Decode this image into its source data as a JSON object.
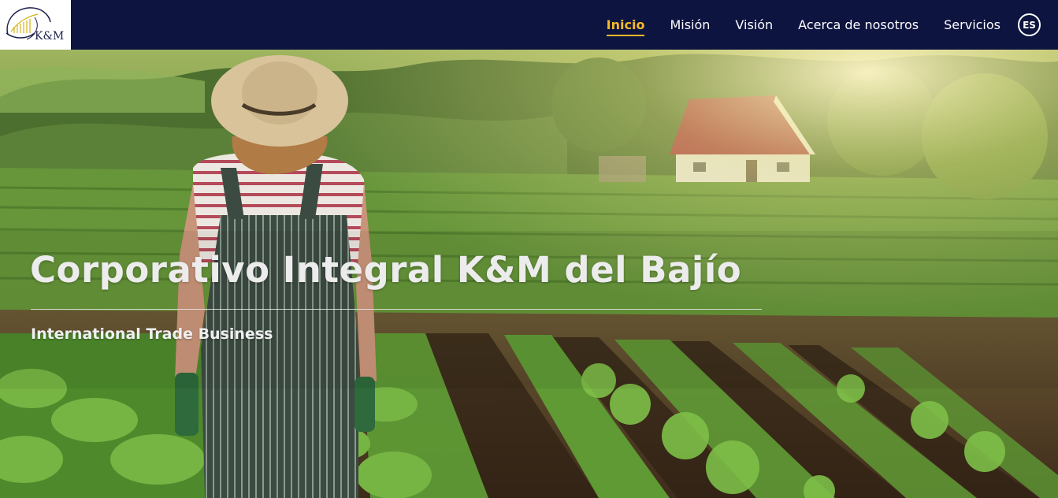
{
  "header": {
    "logo_text": "K&M",
    "nav": [
      {
        "label": "Inicio",
        "active": true
      },
      {
        "label": "Misión",
        "active": false
      },
      {
        "label": "Visión",
        "active": false
      },
      {
        "label": "Acerca de nosotros",
        "active": false
      },
      {
        "label": "Servicios",
        "active": false
      }
    ],
    "language": "ES"
  },
  "hero": {
    "title": "Corporativo Integral K&M del Bajío",
    "subtitle": "International Trade Business",
    "image": "farmer-in-field-image"
  },
  "colors": {
    "navbar_bg": "#0d1440",
    "accent": "#f5b928",
    "text_light": "#ececec"
  }
}
